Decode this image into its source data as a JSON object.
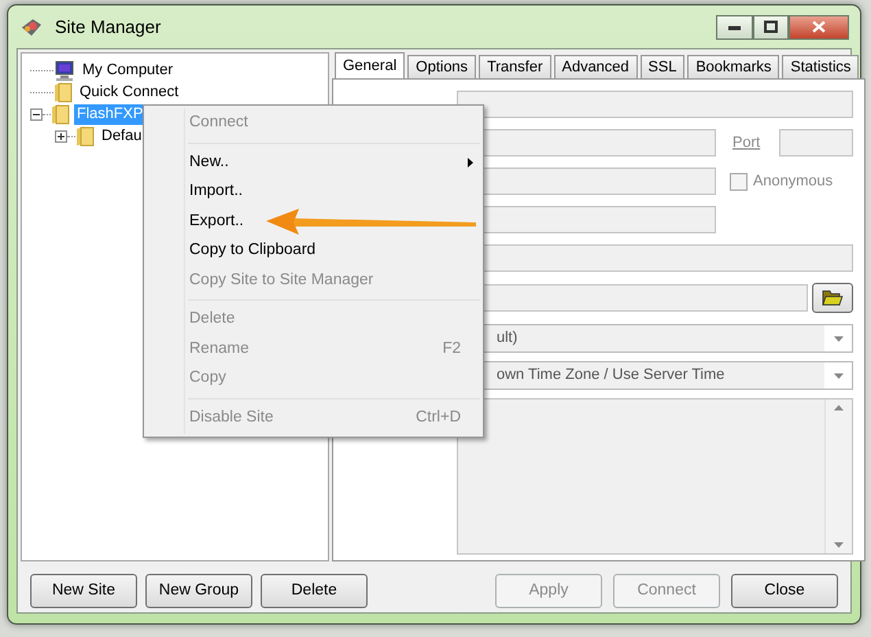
{
  "window": {
    "title": "Site Manager"
  },
  "tree": [
    {
      "label": "My Computer",
      "kind": "computer",
      "selected": false
    },
    {
      "label": "Quick Connect",
      "kind": "folder",
      "selected": false
    },
    {
      "label": "FlashFXP",
      "kind": "folder",
      "selected": true,
      "expanded": true,
      "children": [
        {
          "label": "Defau",
          "kind": "folder",
          "selected": false,
          "expanded": false
        }
      ]
    }
  ],
  "tabs": [
    {
      "label": "General",
      "selected": true
    },
    {
      "label": "Options",
      "selected": false
    },
    {
      "label": "Transfer",
      "selected": false
    },
    {
      "label": "Advanced",
      "selected": false
    },
    {
      "label": "SSL",
      "selected": false
    },
    {
      "label": "Bookmarks",
      "selected": false
    },
    {
      "label": "Statistics",
      "selected": false
    }
  ],
  "form": [
    {
      "kind": "wide-field"
    },
    {
      "kind": "port-field",
      "label": "Port",
      "disabled": true
    },
    {
      "kind": "check-field",
      "label": "Anonymous",
      "checked": false,
      "disabled": true
    },
    {
      "kind": "field"
    },
    {
      "kind": "wide-field"
    },
    {
      "kind": "path-field"
    },
    {
      "kind": "select",
      "value": "ult)"
    },
    {
      "kind": "select",
      "value": "own Time Zone / Use Server Time"
    },
    {
      "kind": "memo"
    }
  ],
  "context_menu": [
    {
      "kind": "item",
      "label": "Connect",
      "disabled": true
    },
    {
      "kind": "separator"
    },
    {
      "kind": "item",
      "label": "New..",
      "disabled": false,
      "submenu": true
    },
    {
      "kind": "item",
      "label": "Import..",
      "disabled": false
    },
    {
      "kind": "item",
      "label": "Export..",
      "disabled": false
    },
    {
      "kind": "item",
      "label": "Copy to Clipboard",
      "disabled": false
    },
    {
      "kind": "item",
      "label": "Copy Site to Site Manager",
      "disabled": true
    },
    {
      "kind": "separator"
    },
    {
      "kind": "item",
      "label": "Delete",
      "disabled": true
    },
    {
      "kind": "item",
      "label": "Rename",
      "shortcut": "F2",
      "disabled": true
    },
    {
      "kind": "item",
      "label": "Copy",
      "disabled": true
    },
    {
      "kind": "separator"
    },
    {
      "kind": "item",
      "label": "Disable Site",
      "shortcut": "Ctrl+D",
      "disabled": true
    }
  ],
  "buttons_left": [
    {
      "label": "New Site",
      "disabled": false
    },
    {
      "label": "New Group",
      "disabled": false
    },
    {
      "label": "Delete",
      "disabled": false
    }
  ],
  "buttons_right": [
    {
      "label": "Apply",
      "disabled": true
    },
    {
      "label": "Connect",
      "disabled": true
    },
    {
      "label": "Close",
      "disabled": false
    }
  ]
}
